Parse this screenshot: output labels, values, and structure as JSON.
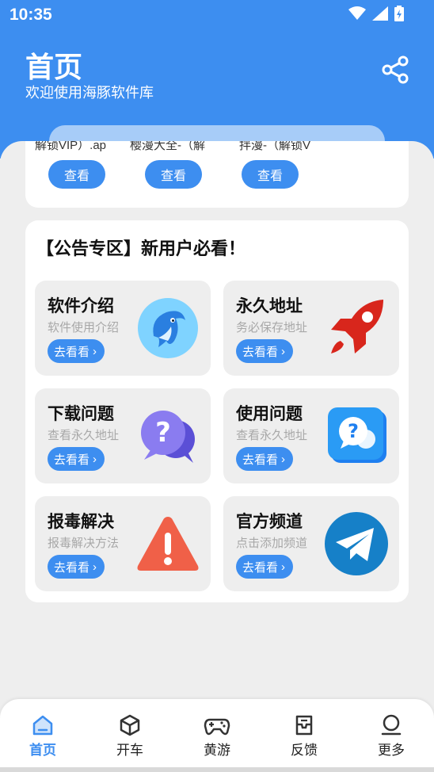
{
  "status": {
    "time": "10:35"
  },
  "header": {
    "title": "首页",
    "subtitle": "欢迎使用海豚软件库"
  },
  "top_section": {
    "items": [
      {
        "label": "解锁VIP）.ap",
        "button": "查看"
      },
      {
        "label": "樱漫大全-（解",
        "button": "查看"
      },
      {
        "label": "拌漫-（解锁V",
        "button": "查看"
      }
    ]
  },
  "notice": {
    "title": "【公告专区】新用户必看！",
    "tiles": [
      {
        "title": "软件介绍",
        "desc": "软件使用介绍",
        "button": "去看看",
        "icon": "dolphin-icon"
      },
      {
        "title": "永久地址",
        "desc": "务必保存地址",
        "button": "去看看",
        "icon": "rocket-icon"
      },
      {
        "title": "下载问题",
        "desc": "查看永久地址",
        "button": "去看看",
        "icon": "question-bubble-icon"
      },
      {
        "title": "使用问题",
        "desc": "查看永久地址",
        "button": "去看看",
        "icon": "question-chat-icon"
      },
      {
        "title": "报毒解决",
        "desc": "报毒解决方法",
        "button": "去看看",
        "icon": "warning-icon"
      },
      {
        "title": "官方频道",
        "desc": "点击添加频道",
        "button": "去看看",
        "icon": "telegram-icon"
      }
    ]
  },
  "nav": {
    "items": [
      {
        "label": "首页",
        "icon": "home-icon"
      },
      {
        "label": "开车",
        "icon": "cube-icon"
      },
      {
        "label": "黄游",
        "icon": "gamepad-icon"
      },
      {
        "label": "反馈",
        "icon": "feedback-icon"
      },
      {
        "label": "更多",
        "icon": "user-icon"
      }
    ]
  },
  "colors": {
    "accent": "#3d8ef0",
    "background": "#eeeeee"
  }
}
